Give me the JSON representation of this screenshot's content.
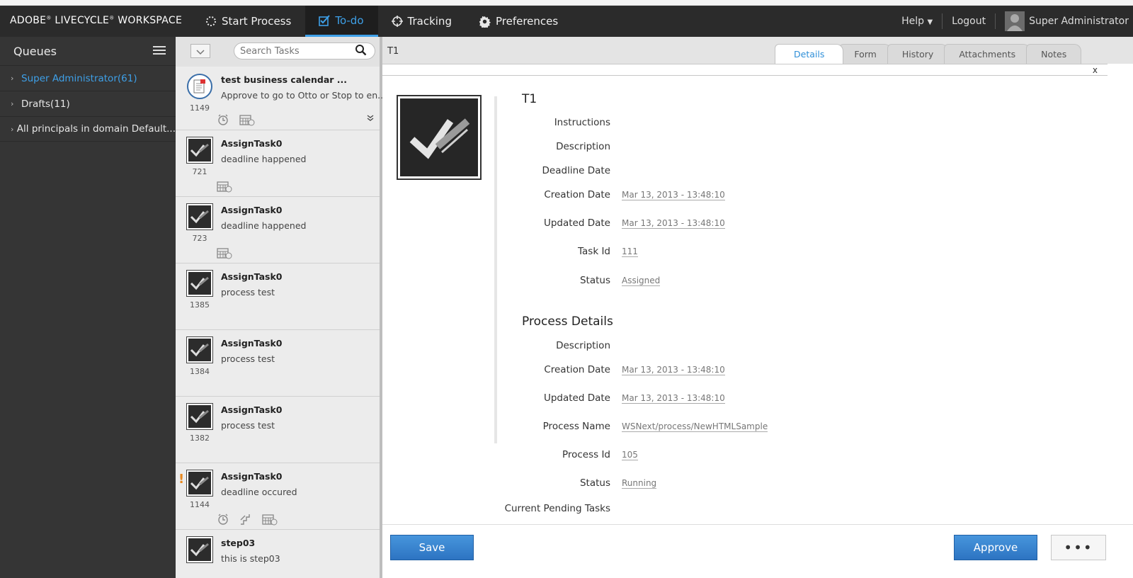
{
  "header": {
    "brand_a": "ADOBE",
    "brand_b": " LIVECYCLE",
    "brand_c": " WORKSPACE",
    "nav": [
      {
        "label": "Start Process",
        "icon": "start-process-icon"
      },
      {
        "label": "To-do",
        "icon": "todo-check-icon",
        "active": true
      },
      {
        "label": "Tracking",
        "icon": "tracking-icon"
      },
      {
        "label": "Preferences",
        "icon": "gear-icon"
      }
    ],
    "help_label": "Help",
    "logout_label": "Logout",
    "user_name": "Super Administrator"
  },
  "queues": {
    "title": "Queues",
    "items": [
      {
        "label": "Super Administrator(61)",
        "selected": true
      },
      {
        "label": "Drafts(11)"
      },
      {
        "label": "All principals in domain Default..."
      }
    ]
  },
  "tasklist": {
    "search_placeholder": "Search Tasks",
    "tasks": [
      {
        "title": "test business calendar ...",
        "desc": "Approve to go to Otto or Stop to en...",
        "id": "1149",
        "icons": [
          "alarm-icon",
          "calendar-icon"
        ],
        "type": "form"
      },
      {
        "title": "AssignTask0",
        "desc": "deadline happened",
        "id": "721",
        "icons": [
          "calendar-icon"
        ]
      },
      {
        "title": "AssignTask0",
        "desc": "deadline happened",
        "id": "723",
        "icons": [
          "calendar-icon"
        ]
      },
      {
        "title": "AssignTask0",
        "desc": "process test",
        "id": "1385",
        "icons": []
      },
      {
        "title": "AssignTask0",
        "desc": "process test",
        "id": "1384",
        "icons": []
      },
      {
        "title": "AssignTask0",
        "desc": "process test",
        "id": "1382",
        "icons": []
      },
      {
        "title": "AssignTask0",
        "desc": "deadline occured",
        "id": "1144",
        "icons": [
          "alarm-icon",
          "escalation-icon",
          "calendar-icon"
        ],
        "priority": "!"
      },
      {
        "title": "step03",
        "desc": "this is step03",
        "id": "",
        "icons": []
      }
    ]
  },
  "detail": {
    "title": "T1",
    "tabs": [
      "Details",
      "Form",
      "History",
      "Attachments",
      "Notes"
    ],
    "active_tab": "Details",
    "close_label": "x",
    "task_heading": "T1",
    "task_fields": [
      {
        "label": "Instructions",
        "value": ""
      },
      {
        "label": "Description",
        "value": ""
      },
      {
        "label": "Deadline Date",
        "value": ""
      },
      {
        "label": "Creation Date",
        "value": "Mar 13, 2013 - 13:48:10"
      },
      {
        "label": "Updated Date",
        "value": "Mar 13, 2013 - 13:48:10"
      },
      {
        "label": "Task Id",
        "value": "111"
      },
      {
        "label": "Status",
        "value": "Assigned"
      }
    ],
    "process_heading": "Process Details",
    "process_fields": [
      {
        "label": "Description",
        "value": ""
      },
      {
        "label": "Creation Date",
        "value": "Mar 13, 2013 - 13:48:10"
      },
      {
        "label": "Updated Date",
        "value": "Mar 13, 2013 - 13:48:10"
      },
      {
        "label": "Process Name",
        "value": "WSNext/process/NewHTMLSample"
      },
      {
        "label": "Process Id",
        "value": "105"
      },
      {
        "label": "Status",
        "value": "Running"
      },
      {
        "label": "Current Pending Tasks",
        "value": ""
      }
    ]
  },
  "footer": {
    "save_label": "Save",
    "approve_label": "Approve",
    "more_label": "•••"
  },
  "colors": {
    "accent": "#3ea0e8",
    "header_bg": "#2b2b2b",
    "sidebar_bg": "#353535",
    "button_blue": "#2d74c2",
    "priority": "#e8881e"
  }
}
